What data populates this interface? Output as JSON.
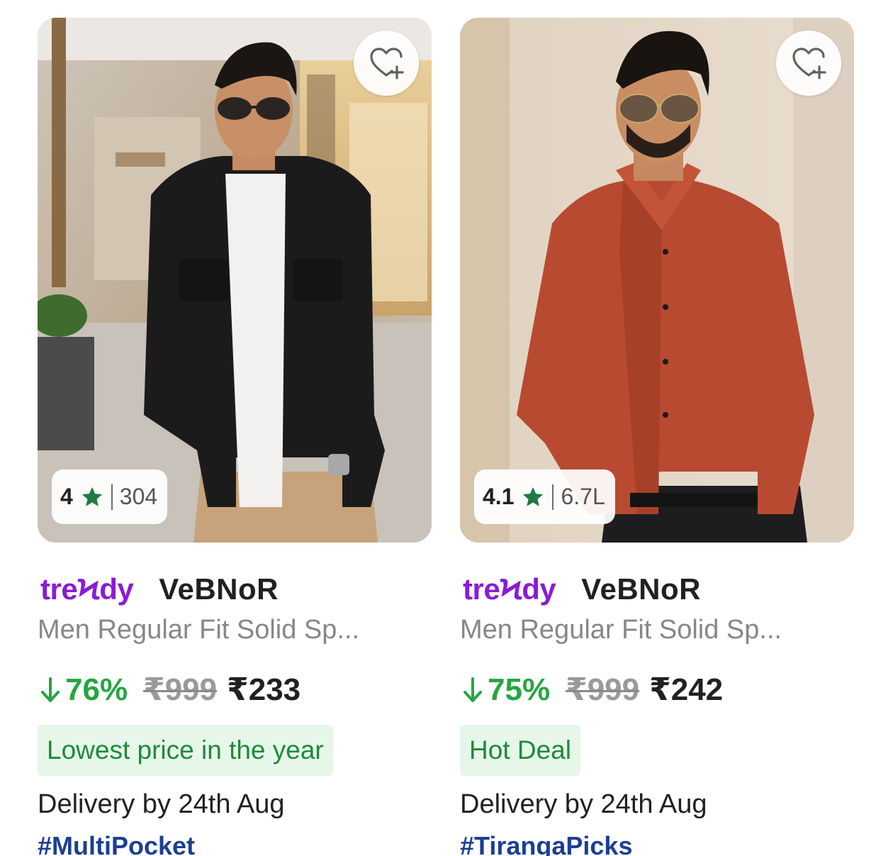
{
  "products": [
    {
      "rating": "4",
      "rating_count": "304",
      "tag": "treϞdy",
      "brand": "VeBNoR",
      "title": "Men Regular Fit Solid Sp...",
      "discount": "76%",
      "mrp": "₹999",
      "price": "₹233",
      "badge": "Lowest price in the year",
      "delivery": "Delivery by 24th Aug",
      "hashtag": "#MultiPocket"
    },
    {
      "rating": "4.1",
      "rating_count": "6.7L",
      "tag": "treϞdy",
      "brand": "VeBNoR",
      "title": "Men Regular Fit Solid Sp...",
      "discount": "75%",
      "mrp": "₹999",
      "price": "₹242",
      "badge": "Hot Deal",
      "delivery": "Delivery by 24th Aug",
      "hashtag": "#TirangaPicks"
    }
  ],
  "icons": {
    "wishlist": "heart-plus-icon",
    "rating_star": "star-icon",
    "discount_arrow": "arrow-down-icon"
  },
  "colors": {
    "discount_green": "#26a541",
    "tag_purple": "#8a1bd6",
    "badge_bg": "#e6f7ea",
    "hashtag_blue": "#1c3f94",
    "star_green": "#1e7a43"
  }
}
